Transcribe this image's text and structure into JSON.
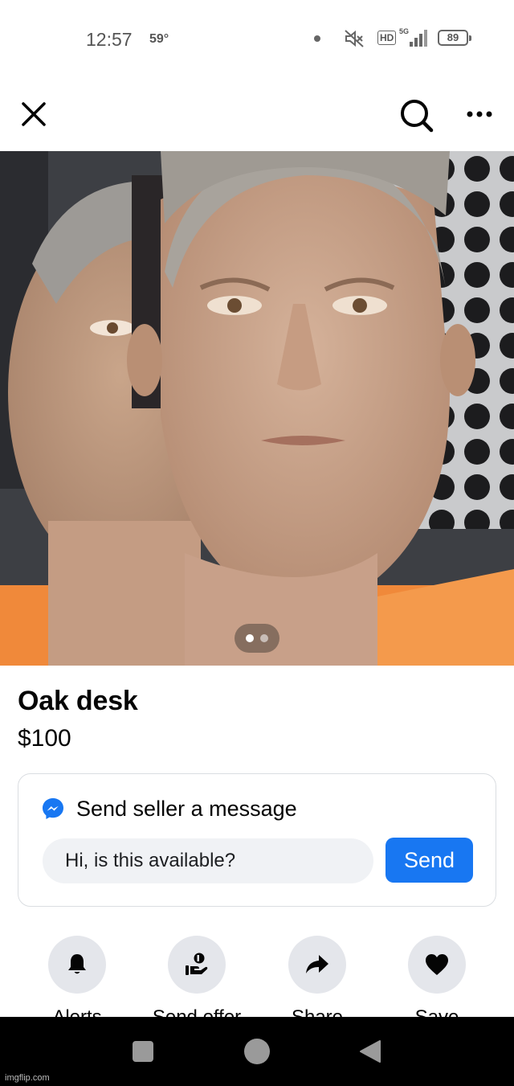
{
  "status_bar": {
    "time": "12:57",
    "temperature": "59°",
    "hd": "HD",
    "network": "5G",
    "battery": "89"
  },
  "nav": {
    "close_icon": "close-icon",
    "search_icon": "search-icon",
    "more_icon": "more-horizontal-icon"
  },
  "photo": {
    "page_count": 2,
    "current_page": 1
  },
  "listing": {
    "title": "Oak desk",
    "price": "$100"
  },
  "message": {
    "heading": "Send seller a message",
    "input_value": "Hi, is this available?",
    "send_label": "Send"
  },
  "actions": [
    {
      "label": "Alerts",
      "icon": "bell-icon"
    },
    {
      "label": "Send offer",
      "icon": "offer-icon"
    },
    {
      "label": "Share",
      "icon": "share-icon"
    },
    {
      "label": "Save",
      "icon": "heart-icon"
    }
  ],
  "colors": {
    "accent": "#1877f2",
    "chip_bg": "#e4e6eb",
    "input_bg": "#f0f2f5"
  },
  "watermark": "imgflip.com"
}
